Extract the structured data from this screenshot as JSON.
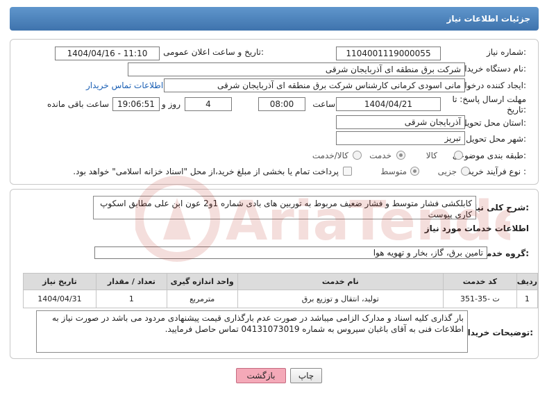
{
  "panel": {
    "title": "جزئیات اطلاعات نیاز"
  },
  "form": {
    "need_number_label": "شماره نیاز:",
    "need_number": "1104001119000055",
    "announce_label": "تاریخ و ساعت اعلان عمومی:",
    "announce_value": "1404/04/16 - 11:10",
    "buyer_org_label": "نام دستگاه خریدار:",
    "buyer_org": "شرکت برق منطقه ای آذربایجان شرقی",
    "creator_label": "ایجاد کننده درخواست:",
    "creator": "مانی اسودی کرمانی کارشناس شرکت برق منطقه ای آذربایجان شرقی",
    "buyer_contact_link": "اطلاعات تماس خریدار",
    "deadline_label_1": "مهلت ارسال پاسخ: تا",
    "deadline_label_2": "تاریخ:",
    "deadline_date": "1404/04/21",
    "hour_label": "ساعت",
    "deadline_time": "08:00",
    "days_value": "4",
    "days_label": "روز و",
    "remaining_time": "19:06:51",
    "remaining_label": "ساعت باقی مانده",
    "province_label": "استان محل تحویل:",
    "province": "آذربایجان شرقی",
    "city_label": "شهر محل تحویل:",
    "city": "تبریز",
    "category_label": "طبقه بندی موضوعی:",
    "category_options": [
      "کالا",
      "خدمت",
      "کالا/خدمت"
    ],
    "category_selected": "خدمت",
    "process_label": "نوع فرآیند خرید :",
    "process_options": [
      "جزیی",
      "متوسط"
    ],
    "process_selected": "متوسط",
    "payment_note": "پرداخت تمام یا بخشی از مبلغ خرید،از محل \"اسناد خزانه اسلامی\" خواهد بود."
  },
  "need_summary": {
    "label": "شرح کلی نیاز:",
    "text": "کابلکشی فشار متوسط و فشار ضعیف مربوط به توربین های بادی شماره 1و2 عون ابن علی مطابق اسکوپ کاری پیوست"
  },
  "services": {
    "section_title": "اطلاعات خدمات مورد نیاز",
    "group_label": "گروه خدمت:",
    "group_value": "تامین برق، گاز، بخار و تهویه هوا",
    "columns": [
      "ردیف",
      "کد خدمت",
      "نام خدمت",
      "واحد اندازه گیری",
      "تعداد / مقدار",
      "تاریخ نیاز"
    ],
    "rows": [
      [
        "1",
        "ت -35-351",
        "تولید، انتقال و توزیع برق",
        "مترمربع",
        "1",
        "1404/04/31"
      ]
    ]
  },
  "buyer_notes": {
    "label": "توضیحات خریدار:",
    "text": "بار گذاری کلیه اسناد و مدارک الزامی میباشد در صورت عدم بارگذاری قیمت پیشنهادی مردود می باشد در صورت نیاز به اطلاعات فنی به آقای باغبان سیروس به شماره 04131073019 تماس حاصل فرمایید."
  },
  "buttons": {
    "print": "چاپ",
    "back": "بازگشت"
  },
  "watermark": {
    "brand": "AriaTender.net"
  },
  "colors": {
    "title_bar": "#4a80bb",
    "link": "#1a5fb4",
    "back_button": "#f4a9b8",
    "table_header": "#dcdcdc"
  }
}
